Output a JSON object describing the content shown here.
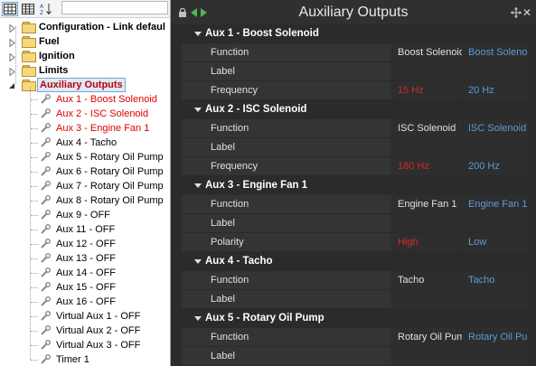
{
  "colors": {
    "accent_blue": "#5b9bd5",
    "warn_red": "#d42a2a",
    "tree_red": "#e00000",
    "dark_bg": "#2b2b2b"
  },
  "toolbar": {
    "buttons": [
      {
        "name": "categorized-view-button",
        "icon": "grid-icon"
      },
      {
        "name": "sort-az-button",
        "icon": "sort-az-icon"
      }
    ],
    "search_value": ""
  },
  "tree": {
    "folders": [
      {
        "label": "Configuration - Link defaul",
        "expanded": false
      },
      {
        "label": "Fuel",
        "expanded": false
      },
      {
        "label": "Ignition",
        "expanded": false
      },
      {
        "label": "Limits",
        "expanded": false
      },
      {
        "label": "Auxiliary Outputs",
        "expanded": true,
        "selected": true
      }
    ],
    "items": [
      {
        "label": "Aux  1 - Boost Solenoid",
        "red": true
      },
      {
        "label": "Aux  2 - ISC Solenoid",
        "red": true
      },
      {
        "label": "Aux  3 - Engine Fan 1",
        "red": true
      },
      {
        "label": "Aux  4 - Tacho",
        "red": false
      },
      {
        "label": "Aux  5 - Rotary Oil Pump",
        "red": false
      },
      {
        "label": "Aux  6 - Rotary Oil Pump",
        "red": false
      },
      {
        "label": "Aux  7 - Rotary Oil Pump",
        "red": false
      },
      {
        "label": "Aux  8 - Rotary Oil Pump",
        "red": false
      },
      {
        "label": "Aux  9 - OFF",
        "red": false
      },
      {
        "label": "Aux 11 - OFF",
        "red": false
      },
      {
        "label": "Aux 12 - OFF",
        "red": false
      },
      {
        "label": "Aux 13 - OFF",
        "red": false
      },
      {
        "label": "Aux 14 - OFF",
        "red": false
      },
      {
        "label": "Aux 15 - OFF",
        "red": false
      },
      {
        "label": "Aux 16 - OFF",
        "red": false
      },
      {
        "label": "Virtual Aux  1 - OFF",
        "red": false
      },
      {
        "label": "Virtual Aux  2 - OFF",
        "red": false
      },
      {
        "label": "Virtual Aux  3 - OFF",
        "red": false
      },
      {
        "label": "Timer 1",
        "red": false
      }
    ]
  },
  "panel": {
    "title": "Auxiliary Outputs",
    "sections": [
      {
        "title": "Aux  1 - Boost Solenoid",
        "rows": [
          {
            "label": "Function",
            "v1": "Boost Solenoid",
            "v2": "Boost Solenoid",
            "v1_red": false
          },
          {
            "label": "Label",
            "v1": "",
            "v2": "",
            "v1_red": false
          },
          {
            "label": "Frequency",
            "v1": "15 Hz",
            "v2": "20 Hz",
            "v1_red": true
          }
        ]
      },
      {
        "title": "Aux  2 - ISC Solenoid",
        "rows": [
          {
            "label": "Function",
            "v1": "ISC Solenoid",
            "v2": "ISC Solenoid",
            "v1_red": false
          },
          {
            "label": "Label",
            "v1": "",
            "v2": "",
            "v1_red": false
          },
          {
            "label": "Frequency",
            "v1": "180 Hz",
            "v2": "200 Hz",
            "v1_red": true
          }
        ]
      },
      {
        "title": "Aux  3 - Engine Fan 1",
        "rows": [
          {
            "label": "Function",
            "v1": "Engine Fan 1",
            "v2": "Engine Fan 1",
            "v1_red": false
          },
          {
            "label": "Label",
            "v1": "",
            "v2": "",
            "v1_red": false
          },
          {
            "label": "Polarity",
            "v1": "High",
            "v2": "Low",
            "v1_red": true
          }
        ]
      },
      {
        "title": "Aux  4 - Tacho",
        "rows": [
          {
            "label": "Function",
            "v1": "Tacho",
            "v2": "Tacho",
            "v1_red": false
          },
          {
            "label": "Label",
            "v1": "",
            "v2": "",
            "v1_red": false
          }
        ]
      },
      {
        "title": "Aux  5 - Rotary Oil Pump",
        "rows": [
          {
            "label": "Function",
            "v1": "Rotary Oil Pump",
            "v2": "Rotary Oil Pump",
            "v1_red": false
          },
          {
            "label": "Label",
            "v1": "",
            "v2": "",
            "v1_red": false
          }
        ]
      }
    ]
  }
}
